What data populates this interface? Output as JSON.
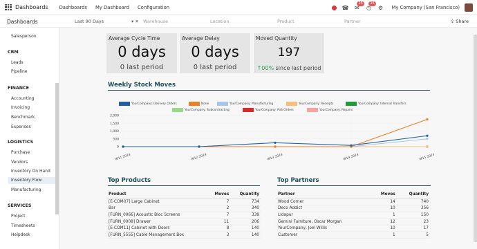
{
  "topbar": {
    "brand": "Dashboards",
    "nav": [
      "Dashboards",
      "My Dashboard",
      "Configuration"
    ],
    "badges": {
      "messages": "15",
      "activities": "15"
    },
    "company": "My Company (San Francisco)"
  },
  "filterbar": {
    "title": "Dashboards",
    "date_filter": "Last 90 Days",
    "warehouse": "Warehouse",
    "location": "Location",
    "product": "Product",
    "partner": "Partner",
    "share": "Share"
  },
  "sidebar": {
    "items_top": [
      "Salesperson"
    ],
    "sections": [
      {
        "title": "CRM",
        "items": [
          "Leads",
          "Pipeline"
        ]
      },
      {
        "title": "FINANCE",
        "items": [
          "Accounting",
          "Invoicing",
          "Benchmark",
          "Expenses"
        ]
      },
      {
        "title": "LOGISTICS",
        "items": [
          "Purchase",
          "Vendors",
          "Inventory On Hand",
          "Inventory Flow",
          "Manufacturing"
        ]
      },
      {
        "title": "SERVICES",
        "items": [
          "Project",
          "Timesheets",
          "Helpdesk"
        ]
      }
    ],
    "active": "Inventory Flow"
  },
  "kpis": [
    {
      "label": "Average Cycle Time",
      "value": "0 days",
      "sub": "0 last period"
    },
    {
      "label": "Average Delay",
      "value": "0 days",
      "sub": "0 last period"
    },
    {
      "label": "Moved Quantity",
      "value": "197",
      "sub_prefix": "↑",
      "sub_pct": "00%",
      "sub": "since last period"
    }
  ],
  "weekly": {
    "title": "Weekly Stock Moves"
  },
  "chart_data": {
    "type": "line",
    "x": [
      "W11 2024",
      "W12 2024",
      "W13 2024",
      "W14 2024",
      "W15 2024"
    ],
    "ylim": [
      0,
      2000
    ],
    "yticks": [
      "2,000",
      "1,500",
      "1,000",
      "500",
      "0"
    ],
    "series": [
      {
        "name": "YourCompany: Delivery Orders",
        "color": "#1f5fa8",
        "values": [
          0,
          0,
          250,
          80,
          700
        ]
      },
      {
        "name": "None",
        "color": "#f07f22",
        "values": [
          0,
          0,
          0,
          0,
          1750
        ]
      },
      {
        "name": "YourCompany: Manufacturing",
        "color": "#a9c5e7",
        "values": [
          0,
          0,
          0,
          0,
          500
        ]
      },
      {
        "name": "YourCompany: Receipts",
        "color": "#f7be7a",
        "values": [
          0,
          0,
          0,
          0,
          0
        ]
      },
      {
        "name": "YourCompany: Internal Transfers",
        "color": "#1f9b3a",
        "values": [
          0,
          0,
          0,
          0,
          0
        ]
      },
      {
        "name": "YourCompany: Subcontracting",
        "color": "#9ad88a",
        "values": [
          0,
          0,
          0,
          0,
          0
        ]
      },
      {
        "name": "YourCompany: PoS Orders",
        "color": "#d62b2b",
        "values": [
          0,
          0,
          0,
          0,
          0
        ]
      },
      {
        "name": "YourCompany: Repairs",
        "color": "#f5a3a3",
        "values": [
          0,
          0,
          0,
          0,
          0
        ]
      }
    ]
  },
  "top_products": {
    "title": "Top Products",
    "headers": [
      "Product",
      "Moves",
      "Quantity"
    ],
    "rows": [
      [
        "[E-COM07] Large Cabinet",
        "7",
        "734"
      ],
      [
        "Bar",
        "2",
        "340"
      ],
      [
        "[FURN_0066] Acoustic Bloc Screens",
        "7",
        "339"
      ],
      [
        "[FURN_0008] Drawer",
        "11",
        "206"
      ],
      [
        "[E-COM11] Cabinet with Doors",
        "8",
        "140"
      ],
      [
        "[FURN_5555] Cable Management Box",
        "3",
        "140"
      ]
    ]
  },
  "top_partners": {
    "title": "Top Partners",
    "headers": [
      "Partner",
      "Moves",
      "Quantity"
    ],
    "rows": [
      [
        "Wood Corner",
        "14",
        "740"
      ],
      [
        "Deco Addict",
        "10",
        "356"
      ],
      [
        "Lidapur",
        "1",
        "150"
      ],
      [
        "Gemini Furniture, Oscar Morgan",
        "12",
        "23"
      ],
      [
        "YourCompany, Joel Willis",
        "10",
        "17"
      ],
      [
        "Customer",
        "1",
        "5"
      ]
    ]
  }
}
